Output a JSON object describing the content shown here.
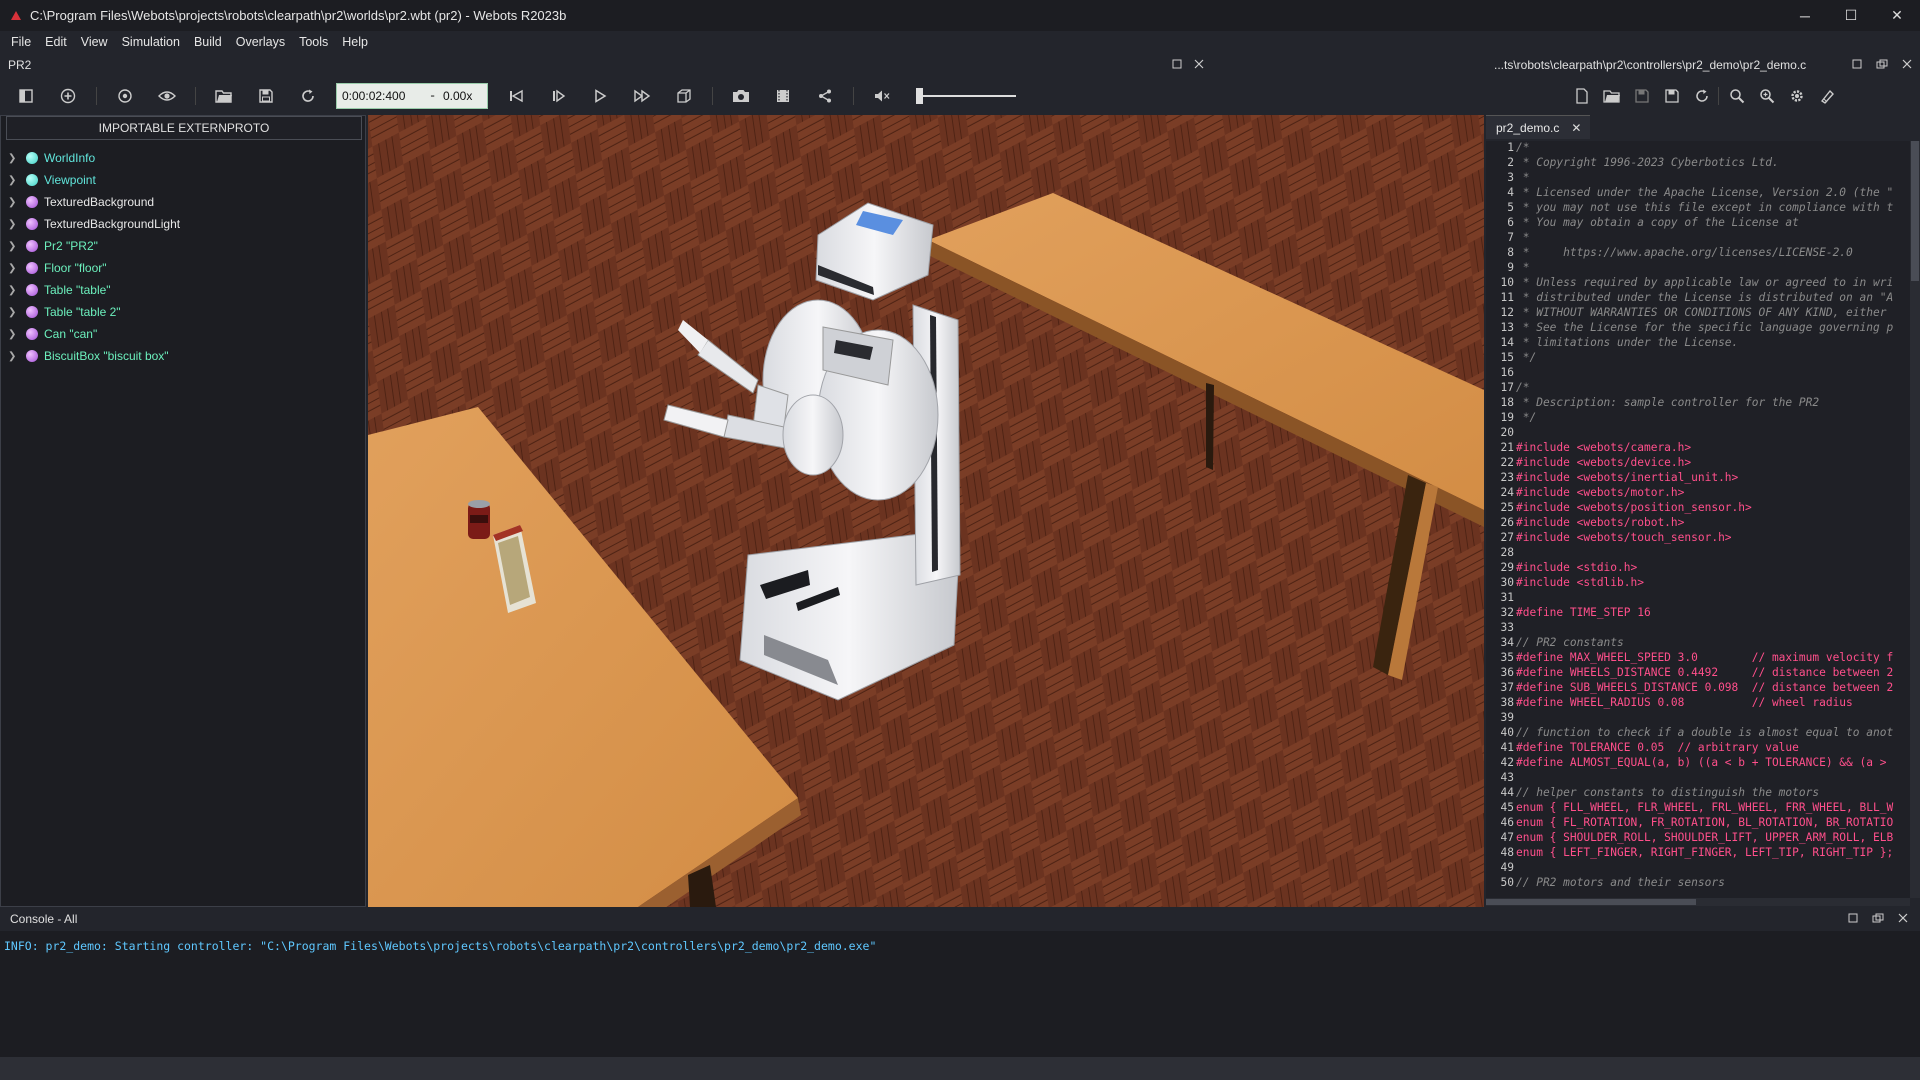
{
  "window": {
    "title": "C:\\Program Files\\Webots\\projects\\robots\\clearpath\\pr2\\worlds\\pr2.wbt (pr2) - Webots R2023b",
    "minimize": "─",
    "maximize": "☐",
    "close": "✕"
  },
  "menu": [
    "File",
    "Edit",
    "View",
    "Simulation",
    "Build",
    "Overlays",
    "Tools",
    "Help"
  ],
  "sim_pane": {
    "title": "PR2",
    "time": "0:00:02:400",
    "dash": "-",
    "speed": "0.00x",
    "volume_level": 0.0
  },
  "scene_tree": {
    "extern_button": "IMPORTABLE EXTERNPROTO",
    "items": [
      {
        "label": "WorldInfo",
        "style": "teal"
      },
      {
        "label": "Viewpoint",
        "style": "teal"
      },
      {
        "label": "TexturedBackground",
        "style": "plain"
      },
      {
        "label": "TexturedBackgroundLight",
        "style": "plain"
      },
      {
        "label": "Pr2 \"PR2\"",
        "style": "green"
      },
      {
        "label": "Floor \"floor\"",
        "style": "green"
      },
      {
        "label": "Table \"table\"",
        "style": "green"
      },
      {
        "label": "Table \"table 2\"",
        "style": "green"
      },
      {
        "label": "Can \"can\"",
        "style": "green"
      },
      {
        "label": "BiscuitBox \"biscuit box\"",
        "style": "green"
      }
    ]
  },
  "editor": {
    "title": "...ts\\robots\\clearpath\\pr2\\controllers\\pr2_demo\\pr2_demo.c",
    "tab": "pr2_demo.c",
    "lines": [
      {
        "n": "1",
        "t": "/*",
        "c": "cm"
      },
      {
        "n": "2",
        "t": " * Copyright 1996-2023 Cyberbotics Ltd.",
        "c": "cm"
      },
      {
        "n": "3",
        "t": " *",
        "c": "cm"
      },
      {
        "n": "4",
        "t": " * Licensed under the Apache License, Version 2.0 (the \"",
        "c": "cm"
      },
      {
        "n": "5",
        "t": " * you may not use this file except in compliance with t",
        "c": "cm"
      },
      {
        "n": "6",
        "t": " * You may obtain a copy of the License at",
        "c": "cm"
      },
      {
        "n": "7",
        "t": " *",
        "c": "cm"
      },
      {
        "n": "8",
        "t": " *     https://www.apache.org/licenses/LICENSE-2.0",
        "c": "cm"
      },
      {
        "n": "9",
        "t": " *",
        "c": "cm"
      },
      {
        "n": "10",
        "t": " * Unless required by applicable law or agreed to in wri",
        "c": "cm"
      },
      {
        "n": "11",
        "t": " * distributed under the License is distributed on an \"A",
        "c": "cm"
      },
      {
        "n": "12",
        "t": " * WITHOUT WARRANTIES OR CONDITIONS OF ANY KIND, either",
        "c": "cm"
      },
      {
        "n": "13",
        "t": " * See the License for the specific language governing p",
        "c": "cm"
      },
      {
        "n": "14",
        "t": " * limitations under the License.",
        "c": "cm"
      },
      {
        "n": "15",
        "t": " */",
        "c": "cm"
      },
      {
        "n": "16",
        "t": "",
        "c": "src"
      },
      {
        "n": "17",
        "t": "/*",
        "c": "cm"
      },
      {
        "n": "18",
        "t": " * Description: sample controller for the PR2",
        "c": "cm"
      },
      {
        "n": "19",
        "t": " */",
        "c": "cm"
      },
      {
        "n": "20",
        "t": "",
        "c": "src"
      },
      {
        "n": "21",
        "t": "#include <webots/camera.h>",
        "c": "pp"
      },
      {
        "n": "22",
        "t": "#include <webots/device.h>",
        "c": "pp"
      },
      {
        "n": "23",
        "t": "#include <webots/inertial_unit.h>",
        "c": "pp"
      },
      {
        "n": "24",
        "t": "#include <webots/motor.h>",
        "c": "pp"
      },
      {
        "n": "25",
        "t": "#include <webots/position_sensor.h>",
        "c": "pp"
      },
      {
        "n": "26",
        "t": "#include <webots/robot.h>",
        "c": "pp"
      },
      {
        "n": "27",
        "t": "#include <webots/touch_sensor.h>",
        "c": "pp"
      },
      {
        "n": "28",
        "t": "",
        "c": "src"
      },
      {
        "n": "29",
        "t": "#include <stdio.h>",
        "c": "pp"
      },
      {
        "n": "30",
        "t": "#include <stdlib.h>",
        "c": "pp"
      },
      {
        "n": "31",
        "t": "",
        "c": "src"
      },
      {
        "n": "32",
        "t": "#define TIME_STEP 16",
        "c": "pp"
      },
      {
        "n": "33",
        "t": "",
        "c": "src"
      },
      {
        "n": "34",
        "t": "// PR2 constants",
        "c": "cm"
      },
      {
        "n": "35",
        "t": "#define MAX_WHEEL_SPEED 3.0        // maximum velocity f",
        "c": "pp"
      },
      {
        "n": "36",
        "t": "#define WHEELS_DISTANCE 0.4492     // distance between 2",
        "c": "pp"
      },
      {
        "n": "37",
        "t": "#define SUB_WHEELS_DISTANCE 0.098  // distance between 2",
        "c": "pp"
      },
      {
        "n": "38",
        "t": "#define WHEEL_RADIUS 0.08          // wheel radius",
        "c": "pp"
      },
      {
        "n": "39",
        "t": "",
        "c": "src"
      },
      {
        "n": "40",
        "t": "// function to check if a double is almost equal to anot",
        "c": "cm"
      },
      {
        "n": "41",
        "t": "#define TOLERANCE 0.05  // arbitrary value",
        "c": "pp"
      },
      {
        "n": "42",
        "t": "#define ALMOST_EQUAL(a, b) ((a < b + TOLERANCE) && (a >",
        "c": "pp"
      },
      {
        "n": "43",
        "t": "",
        "c": "src"
      },
      {
        "n": "44",
        "t": "// helper constants to distinguish the motors",
        "c": "cm"
      },
      {
        "n": "45",
        "t": "enum { FLL_WHEEL, FLR_WHEEL, FRL_WHEEL, FRR_WHEEL, BLL_W",
        "c": "en"
      },
      {
        "n": "46",
        "t": "enum { FL_ROTATION, FR_ROTATION, BL_ROTATION, BR_ROTATIO",
        "c": "en"
      },
      {
        "n": "47",
        "t": "enum { SHOULDER_ROLL, SHOULDER_LIFT, UPPER_ARM_ROLL, ELB",
        "c": "en"
      },
      {
        "n": "48",
        "t": "enum { LEFT_FINGER, RIGHT_FINGER, LEFT_TIP, RIGHT_TIP };",
        "c": "en"
      },
      {
        "n": "49",
        "t": "",
        "c": "src"
      },
      {
        "n": "50",
        "t": "// PR2 motors and their sensors",
        "c": "cm"
      }
    ]
  },
  "console": {
    "title": "Console - All",
    "message": "INFO: pr2_demo: Starting controller: \"C:\\Program Files\\Webots\\projects\\robots\\clearpath\\pr2\\controllers\\pr2_demo\\pr2_demo.exe\""
  },
  "colors": {
    "background": "#23252c",
    "panel": "#1c1d22",
    "teal_node": "#61e6dc",
    "green_node": "#6cf0bd",
    "preprocessor": "#ff4f8b",
    "console_info": "#5fc8ff"
  }
}
